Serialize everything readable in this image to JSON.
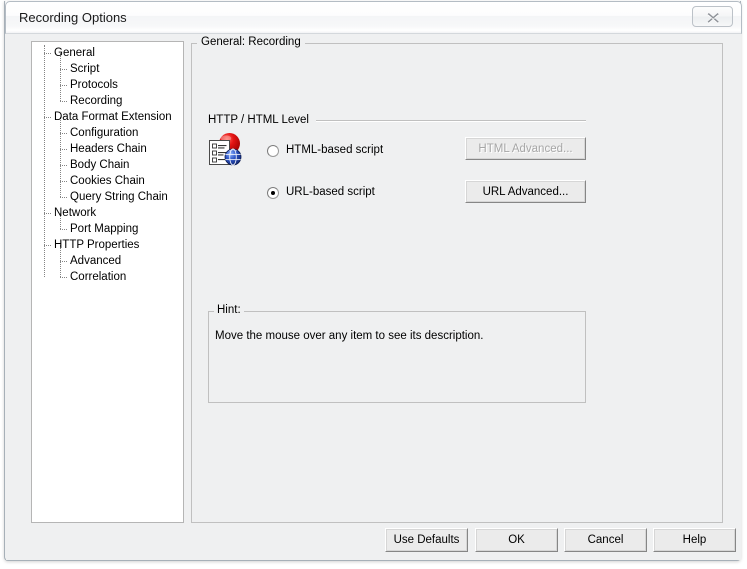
{
  "window": {
    "title": "Recording Options",
    "close_icon": "close-icon",
    "close_label": "Close"
  },
  "tree": {
    "items": [
      {
        "label": "General",
        "level": 0
      },
      {
        "label": "Script",
        "level": 1
      },
      {
        "label": "Protocols",
        "level": 1
      },
      {
        "label": "Recording",
        "level": 1
      },
      {
        "label": "Data Format Extension",
        "level": 0
      },
      {
        "label": "Configuration",
        "level": 1
      },
      {
        "label": "Headers Chain",
        "level": 1
      },
      {
        "label": "Body Chain",
        "level": 1
      },
      {
        "label": "Cookies Chain",
        "level": 1
      },
      {
        "label": "Query String Chain",
        "level": 1
      },
      {
        "label": "Network",
        "level": 0
      },
      {
        "label": "Port Mapping",
        "level": 1
      },
      {
        "label": "HTTP Properties",
        "level": 0
      },
      {
        "label": "Advanced",
        "level": 1
      },
      {
        "label": "Correlation",
        "level": 1
      }
    ]
  },
  "main": {
    "group_title": "General: Recording",
    "level_section": {
      "title": "HTTP / HTML Level",
      "icon": "record-script-icon",
      "options": [
        {
          "label": "HTML-based script",
          "selected": false
        },
        {
          "label": "URL-based script",
          "selected": true
        }
      ],
      "buttons": [
        {
          "label": "HTML Advanced...",
          "enabled": false
        },
        {
          "label": "URL Advanced...",
          "enabled": true
        }
      ]
    },
    "hint": {
      "title": "Hint:",
      "text": "Move the mouse over any item to see its description."
    }
  },
  "footer": {
    "buttons": [
      {
        "label": "Use Defaults"
      },
      {
        "label": "OK"
      },
      {
        "label": "Cancel"
      },
      {
        "label": "Help"
      }
    ]
  },
  "colors": {
    "dialog_bg": "#eff0f1",
    "panel_bg": "#ffffff",
    "border": "#c0c0c0",
    "accent_red": "#d40000",
    "accent_blue": "#2a4fc0",
    "disabled_text": "#a6a6a6"
  }
}
